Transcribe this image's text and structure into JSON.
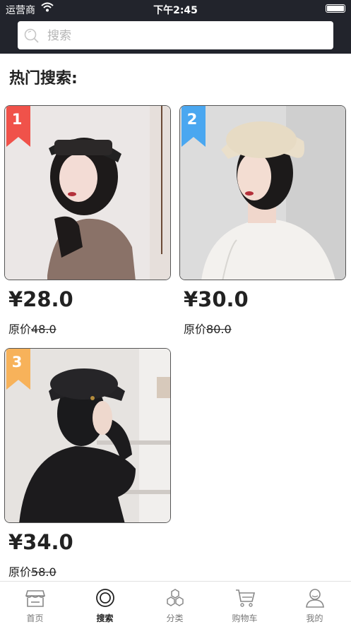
{
  "status_bar": {
    "carrier": "运营商",
    "time": "下午2:45"
  },
  "search": {
    "placeholder": "搜索",
    "value": ""
  },
  "section": {
    "title": "热门搜索:"
  },
  "products": [
    {
      "rank": "1",
      "price": "¥28.0",
      "original_label": "原价",
      "original_price": "48.0",
      "badge_color": "#f0524a"
    },
    {
      "rank": "2",
      "price": "¥30.0",
      "original_label": "原价",
      "original_price": "80.0",
      "badge_color": "#4aa7f0"
    },
    {
      "rank": "3",
      "price": "¥34.0",
      "original_label": "原价",
      "original_price": "58.0",
      "badge_color": "#f7b25a"
    }
  ],
  "tabbar": {
    "items": [
      {
        "label": "首页",
        "icon": "store-icon"
      },
      {
        "label": "搜索",
        "icon": "search-icon",
        "active": true
      },
      {
        "label": "分类",
        "icon": "hexagons-icon"
      },
      {
        "label": "购物车",
        "icon": "cart-icon"
      },
      {
        "label": "我的",
        "icon": "user-icon"
      }
    ]
  }
}
